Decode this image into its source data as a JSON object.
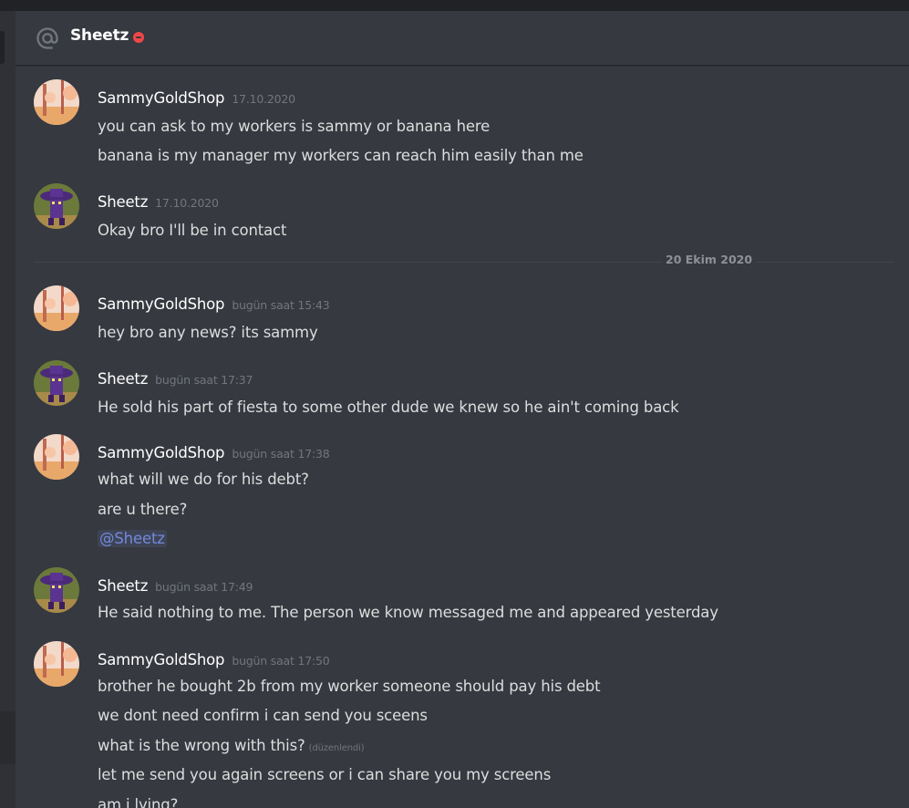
{
  "header": {
    "title": "Sheetz",
    "status_icon": "dnd-icon"
  },
  "date_divider": "20 Ekim 2020",
  "colors": {
    "accent": "#7289da",
    "dnd": "#f04747",
    "background": "#36393f"
  },
  "messages": [
    {
      "author": "SammyGoldShop",
      "time": "17.10.2020",
      "lines": [
        "you can ask to my workers is sammy or banana here",
        "banana is my manager my workers can reach him easily than me"
      ]
    },
    {
      "author": "Sheetz",
      "time": "17.10.2020",
      "lines": [
        "Okay bro I'll be in contact"
      ]
    },
    {
      "author": "SammyGoldShop",
      "time": "bugün saat 15:43",
      "lines": [
        "hey bro any news? its sammy"
      ]
    },
    {
      "author": "Sheetz",
      "time": "bugün saat 17:37",
      "lines": [
        "He sold his part of fiesta to some other dude we knew so he ain't coming back"
      ]
    },
    {
      "author": "SammyGoldShop",
      "time": "bugün saat 17:38",
      "lines": [
        "what will we do for his debt?",
        "are u there?",
        "@Sheetz"
      ]
    },
    {
      "author": "Sheetz",
      "time": "bugün saat 17:49",
      "lines": [
        "He said nothing to me. The person we know messaged me and appeared yesterday"
      ]
    },
    {
      "author": "SammyGoldShop",
      "time": "bugün saat 17:50",
      "lines": [
        "brother he bought 2b from my worker someone should pay his debt",
        "we dont need confirm i can send you sceens",
        "what is the wrong with this?",
        "let me send you again screens or i can share you my screens",
        "am i lying?"
      ],
      "edited_label": "(düzenlendi)"
    }
  ]
}
